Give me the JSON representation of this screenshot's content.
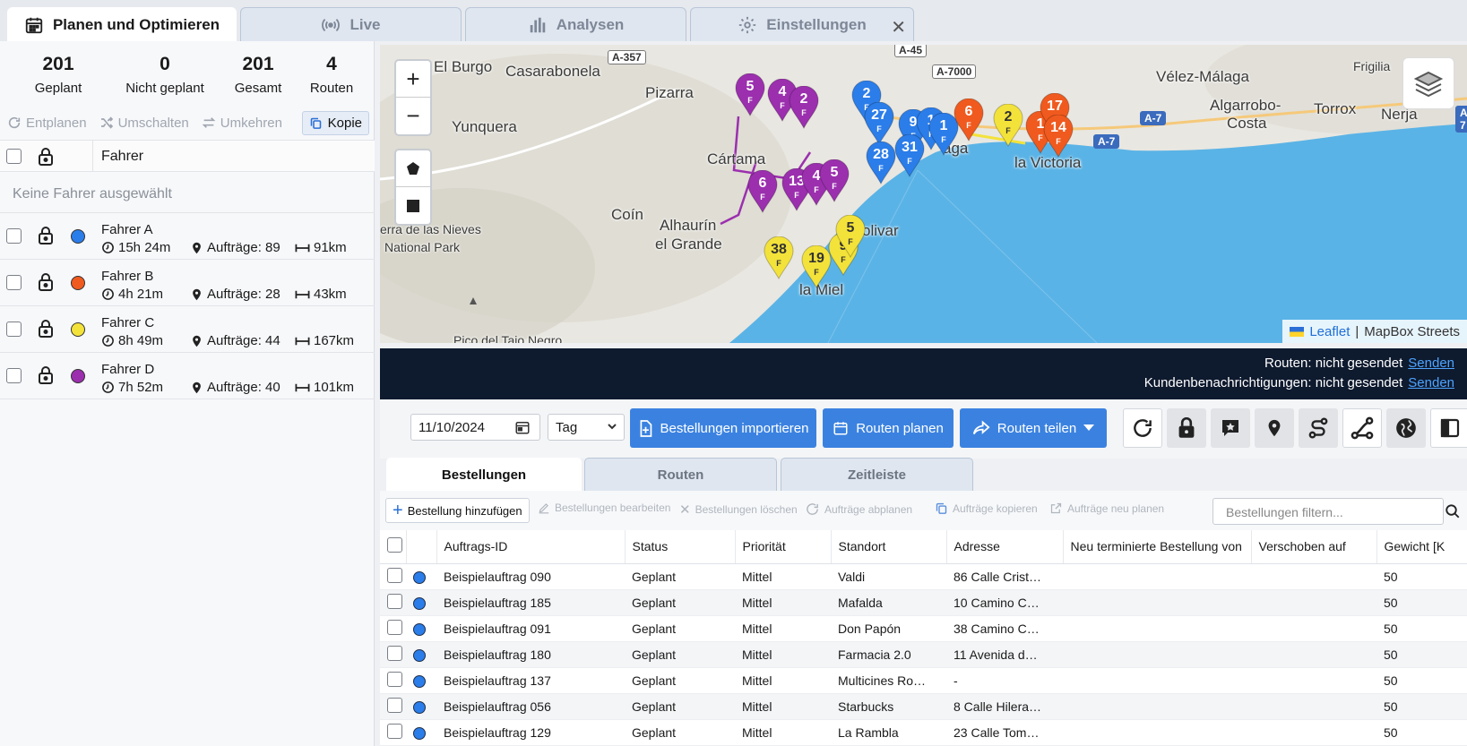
{
  "top_tabs": [
    {
      "label": "Planen und Optimieren",
      "icon": "calendar-icon"
    },
    {
      "label": "Live",
      "icon": "broadcast-icon"
    },
    {
      "label": "Analysen",
      "icon": "bar-chart-icon"
    },
    {
      "label": "Einstellungen",
      "icon": "gear-icon"
    }
  ],
  "stats": [
    {
      "value": "201",
      "label": "Geplant"
    },
    {
      "value": "0",
      "label": "Nicht geplant"
    },
    {
      "value": "201",
      "label": "Gesamt"
    },
    {
      "value": "4",
      "label": "Routen"
    }
  ],
  "actions": {
    "unplan": "Entplanen",
    "toggle": "Umschalten",
    "reverse": "Umkehren",
    "copy": "Kopie"
  },
  "driver_list": {
    "header": "Fahrer",
    "empty_text": "Keine Fahrer ausgewählt",
    "drivers": [
      {
        "name": "Fahrer A",
        "color": "#2b7de9",
        "duration": "15h 24m",
        "orders": "Aufträge: 89",
        "distance": "91km"
      },
      {
        "name": "Fahrer B",
        "color": "#f05a1e",
        "duration": "4h 21m",
        "orders": "Aufträge: 28",
        "distance": "43km"
      },
      {
        "name": "Fahrer C",
        "color": "#f3e23a",
        "duration": "8h 49m",
        "orders": "Aufträge: 44",
        "distance": "167km"
      },
      {
        "name": "Fahrer D",
        "color": "#9b2fae",
        "duration": "7h 52m",
        "orders": "Aufträge: 40",
        "distance": "101km"
      }
    ]
  },
  "map": {
    "labels": {
      "el_burgo": "El Burgo",
      "casarabonela": "Casarabonela",
      "pizarra": "Pizarra",
      "yunquera": "Yunquera",
      "cartama": "Cártama",
      "coin": "Coín",
      "alhaurin1": "Alhaurín",
      "alhaurin2": "el Grande",
      "nieves1": "erra de las Nieves",
      "nieves2": "National Park",
      "malaga_frag": "aga",
      "velez": "Vélez-Málaga",
      "frigilia": "Frigilia",
      "algarrobo1": "Algarrobo-",
      "algarrobo2": "Costa",
      "torrox": "Torrox",
      "nerja": "Nerja",
      "victoria": "la Victoria",
      "olivar": "olivar",
      "pico": "Pico del Taio Negro",
      "miel": "la Miel"
    },
    "roads": {
      "a357": "A-357",
      "a45": "A-45",
      "a7000": "A-7000",
      "a7a": "A-7",
      "a7b": "A-7",
      "a7c": "A-7"
    },
    "pins": [
      {
        "n": "5",
        "c": "#9b2fae"
      },
      {
        "n": "4",
        "c": "#9b2fae"
      },
      {
        "n": "2",
        "c": "#9b2fae"
      },
      {
        "n": "6",
        "c": "#9b2fae"
      },
      {
        "n": "13",
        "c": "#9b2fae"
      },
      {
        "n": "4",
        "c": "#9b2fae"
      },
      {
        "n": "5",
        "c": "#9b2fae"
      },
      {
        "n": "2",
        "c": "#2b7de9"
      },
      {
        "n": "27",
        "c": "#2b7de9"
      },
      {
        "n": "9",
        "c": "#2b7de9"
      },
      {
        "n": "1",
        "c": "#2b7de9"
      },
      {
        "n": "28",
        "c": "#2b7de9"
      },
      {
        "n": "31",
        "c": "#2b7de9"
      },
      {
        "n": "1",
        "c": "#2b7de9"
      },
      {
        "n": "6",
        "c": "#f05a1e"
      },
      {
        "n": "1",
        "c": "#f05a1e"
      },
      {
        "n": "17",
        "c": "#f05a1e"
      },
      {
        "n": "14",
        "c": "#f05a1e"
      },
      {
        "n": "2",
        "c": "#f3e23a"
      },
      {
        "n": "38",
        "c": "#f3e23a"
      },
      {
        "n": "19",
        "c": "#f3e23a"
      },
      {
        "n": "9",
        "c": "#f3e23a"
      },
      {
        "n": "5",
        "c": "#f3e23a"
      }
    ],
    "attribution_leaflet": "Leaflet",
    "attribution_sep": "|",
    "attribution_tiles": "MapBox Streets"
  },
  "banner": {
    "routes_status": "Routen: nicht gesendet",
    "notify_status": "Kundenbenachrichtigungen: nicht gesendet",
    "send": "Senden"
  },
  "toolbar": {
    "date": "11/10/2024",
    "period": "Tag",
    "import_label": "Bestellungen importieren",
    "plan_label": "Routen planen",
    "share_label": "Routen teilen"
  },
  "subtabs": [
    "Bestellungen",
    "Routen",
    "Zeitleiste"
  ],
  "grid_tools": {
    "add": "Bestellung hinzufügen",
    "edit": "Bestellungen bearbeiten",
    "delete": "Bestellungen löschen",
    "unplan": "Aufträge abplanen",
    "copy": "Aufträge kopieren",
    "replan": "Aufträge neu planen",
    "filter_placeholder": "Bestellungen filtern..."
  },
  "table": {
    "columns": [
      "Auftrags-ID",
      "Status",
      "Priorität",
      "Standort",
      "Adresse",
      "Neu terminierte Bestellung von",
      "Verschoben auf",
      "Gewicht [K"
    ],
    "rows": [
      {
        "id": "Beispielauftrag 090",
        "status": "Geplant",
        "priority": "Mittel",
        "location": "Valdi",
        "address": "86 Calle Crist…",
        "weight": "50"
      },
      {
        "id": "Beispielauftrag 185",
        "status": "Geplant",
        "priority": "Mittel",
        "location": "Mafalda",
        "address": "10 Camino C…",
        "weight": "50"
      },
      {
        "id": "Beispielauftrag 091",
        "status": "Geplant",
        "priority": "Mittel",
        "location": "Don Papón",
        "address": "38 Camino C…",
        "weight": "50"
      },
      {
        "id": "Beispielauftrag 180",
        "status": "Geplant",
        "priority": "Mittel",
        "location": "Farmacia 2.0",
        "address": "11 Avenida d…",
        "weight": "50"
      },
      {
        "id": "Beispielauftrag 137",
        "status": "Geplant",
        "priority": "Mittel",
        "location": "Multicines Ro…",
        "address": "-",
        "weight": "50"
      },
      {
        "id": "Beispielauftrag 056",
        "status": "Geplant",
        "priority": "Mittel",
        "location": "Starbucks",
        "address": "8 Calle Hilera…",
        "weight": "50"
      },
      {
        "id": "Beispielauftrag 129",
        "status": "Geplant",
        "priority": "Mittel",
        "location": "La Rambla",
        "address": "23 Calle Tom…",
        "weight": "50"
      }
    ]
  }
}
